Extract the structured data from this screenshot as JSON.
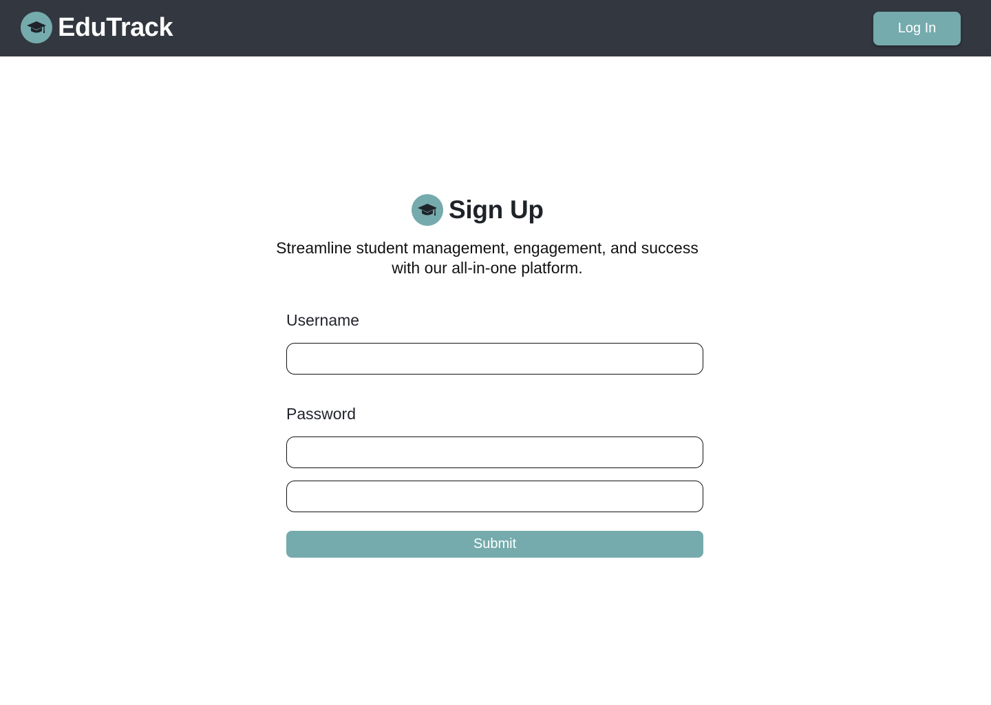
{
  "header": {
    "brand_name": "EduTrack",
    "brand_icon": "graduation-cap-icon",
    "login_label": "Log In"
  },
  "form": {
    "icon": "graduation-cap-icon",
    "title": "Sign Up",
    "subtitle": "Streamline student management, engagement, and success with our all-in-one platform.",
    "username_label": "Username",
    "username_value": "",
    "password_label": "Password",
    "password_value": "",
    "confirm_password_value": "",
    "submit_label": "Submit"
  },
  "colors": {
    "header_background": "#333740",
    "accent": "#75abad",
    "text": "#1f2329"
  }
}
